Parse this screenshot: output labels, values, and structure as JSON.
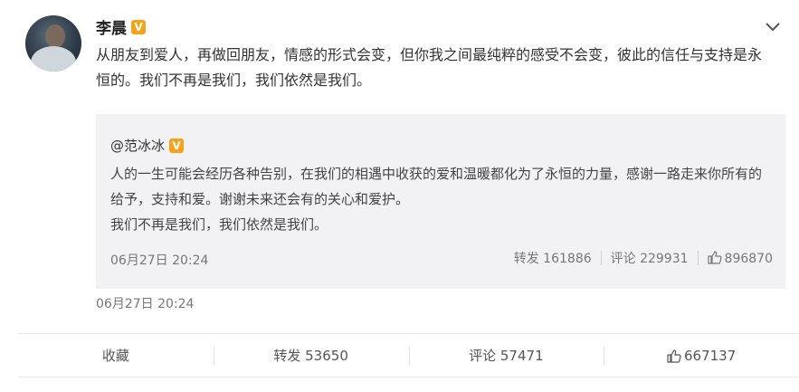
{
  "post": {
    "author": "李晨",
    "verified_badge": "V",
    "text": "从朋友到爱人，再做回朋友，情感的形式会变，但你我之间最纯粹的感受不会变，彼此的信任与支持是永恒的。我们不再是我们，我们依然是我们。",
    "time": "06月27日 20:24"
  },
  "repost": {
    "author": "@范冰冰",
    "verified_badge": "V",
    "text_lines": [
      "人的一生可能会经历各种告别，在我们的相遇中收获的爱和温暖都化为了永恒的力量，感谢一路走来你所有的给予，支持和爱。谢谢未来还会有的关心和爱护。",
      "我们不再是我们，我们依然是我们。"
    ],
    "time": "06月27日 20:24",
    "repost_label": "转发 161886",
    "comment_label": "评论 229931",
    "like_count": "896870"
  },
  "actions": {
    "favorite": "收藏",
    "repost": "转发 53650",
    "comment": "评论 57471",
    "like_count": "667137"
  },
  "colors": {
    "badge": "#f8a21a",
    "repost_background": "#f2f2f5"
  },
  "icons": [
    "chevron-down-icon",
    "like-icon",
    "verified-badge-icon"
  ]
}
